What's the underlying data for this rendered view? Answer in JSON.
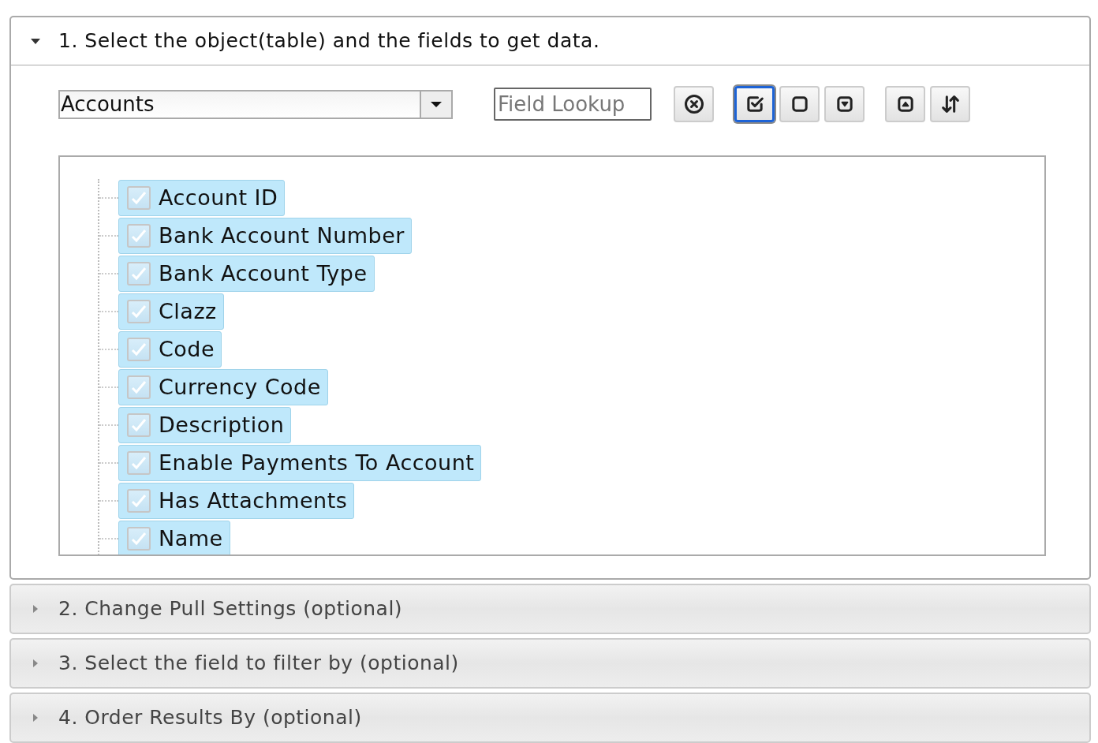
{
  "sections": [
    {
      "title": "1. Select the object(table) and the fields to get data.",
      "expanded": true
    },
    {
      "title": "2. Change Pull Settings (optional)",
      "expanded": false
    },
    {
      "title": "3. Select the field to filter by (optional)",
      "expanded": false
    },
    {
      "title": "4. Order Results By (optional)",
      "expanded": false
    }
  ],
  "object_select": {
    "value": "Accounts"
  },
  "field_lookup": {
    "placeholder": "Field Lookup"
  },
  "toolbar": [
    {
      "kind": "clear",
      "focused": false
    },
    {
      "kind": "check-all",
      "focused": true
    },
    {
      "kind": "uncheck-all",
      "focused": false
    },
    {
      "kind": "collapse",
      "focused": false
    },
    {
      "kind": "expand",
      "focused": false
    },
    {
      "kind": "sort",
      "focused": false
    }
  ],
  "fields": [
    {
      "label": "Account ID",
      "checked": true
    },
    {
      "label": "Bank Account Number",
      "checked": true
    },
    {
      "label": "Bank Account Type",
      "checked": true
    },
    {
      "label": "Clazz",
      "checked": true
    },
    {
      "label": "Code",
      "checked": true
    },
    {
      "label": "Currency Code",
      "checked": true
    },
    {
      "label": "Description",
      "checked": true
    },
    {
      "label": "Enable Payments To Account",
      "checked": true
    },
    {
      "label": "Has Attachments",
      "checked": true
    },
    {
      "label": "Name",
      "checked": true
    }
  ]
}
